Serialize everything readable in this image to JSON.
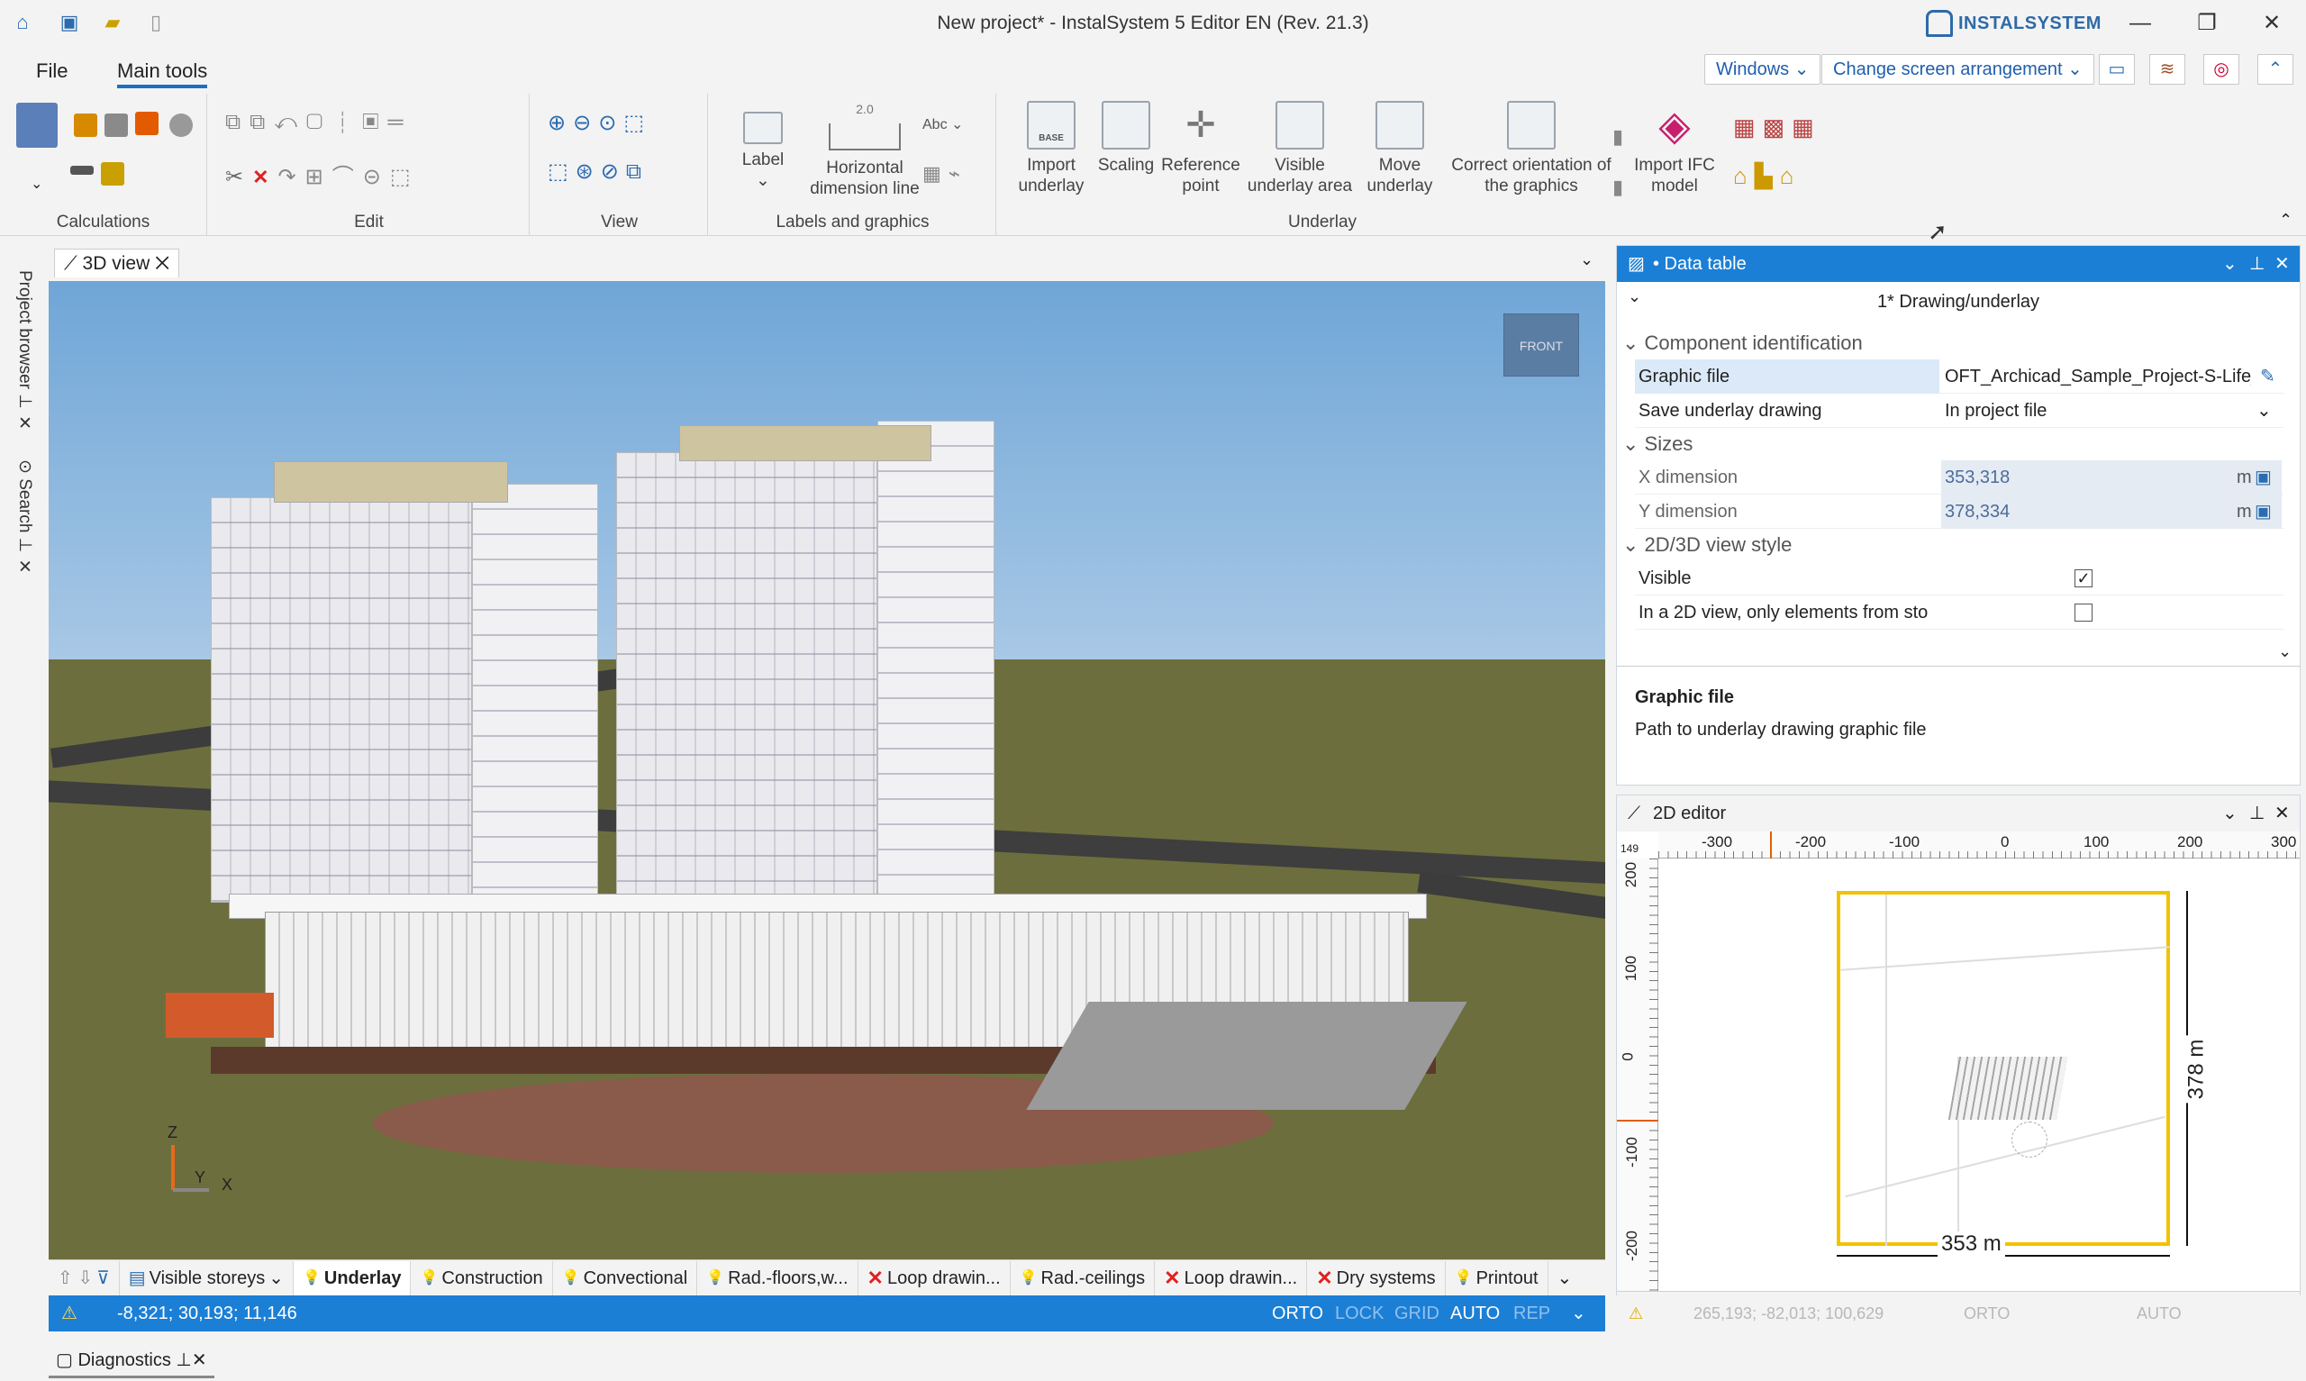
{
  "window": {
    "title": "New project* - InstalSystem 5 Editor EN (Rev. 21.3)",
    "brand": "INSTALSYSTEM"
  },
  "menu": {
    "file": "File",
    "main_tools": "Main tools",
    "windows": "Windows",
    "change_arrangement": "Change screen arrangement"
  },
  "ribbon": {
    "groups": {
      "calculations": "Calculations",
      "edit": "Edit",
      "view": "View",
      "labels_graphics": "Labels and graphics",
      "underlay": "Underlay"
    },
    "label": "Label",
    "horizontal_dimension_line": "Horizontal dimension line",
    "dim_value": "2.0",
    "abc": "Abc",
    "import_underlay": "Import underlay",
    "base": "BASE",
    "scaling": "Scaling",
    "reference_point": "Reference point",
    "visible_underlay_area": "Visible underlay area",
    "move_underlay": "Move underlay",
    "correct_orientation": "Correct orientation of the graphics",
    "import_ifc": "Import IFC model"
  },
  "left_tabs": {
    "project_browser": "Project browser",
    "search": "Search"
  },
  "view3d": {
    "tab": "3D view",
    "cube_label": "FRONT",
    "axis_z": "Z",
    "axis_y": "Y",
    "axis_x": "X"
  },
  "layers": {
    "visible_storeys": "Visible storeys",
    "items": [
      "Underlay",
      "Construction",
      "Convectional",
      "Rad.-floors,w...",
      "Loop drawin...",
      "Rad.-ceilings",
      "Loop drawin...",
      "Dry systems",
      "Printout"
    ]
  },
  "status": {
    "coords": "-8,321; 30,193; 11,146",
    "orto": "ORTO",
    "lock": "LOCK",
    "grid": "GRID",
    "auto": "AUTO",
    "rep": "REP"
  },
  "diagnostics": "Diagnostics",
  "data_table": {
    "title": "• Data table",
    "subtitle": "1* Drawing/underlay",
    "sections": {
      "component_identification": "Component identification",
      "sizes": "Sizes",
      "view_style": "2D/3D view style"
    },
    "rows": {
      "graphic_file_label": "Graphic file",
      "graphic_file_value": "OFT_Archicad_Sample_Project-S-Life_E",
      "save_underlay_label": "Save underlay drawing",
      "save_underlay_value": "In project file",
      "x_dim_label": "X dimension",
      "x_dim_value": "353,318",
      "y_dim_label": "Y dimension",
      "y_dim_value": "378,334",
      "unit": "m",
      "visible_label": "Visible",
      "visible_checked": true,
      "only_elements_label": "In a 2D view, only elements from sto",
      "only_elements_checked": false
    },
    "help_title": "Graphic file",
    "help_text": "Path to underlay drawing graphic file"
  },
  "editor2d": {
    "title": "2D editor",
    "hticks": [
      "-300",
      "-200",
      "-100",
      "0",
      "100",
      "200",
      "300"
    ],
    "hstart": "149",
    "vticks": [
      "200",
      "100",
      "0",
      "-100",
      "-200"
    ],
    "width_label": "353 m",
    "height_label": "378 m",
    "storey_value": "0",
    "status_coords": "265,193; -82,013; 100,629",
    "status_orto": "ORTO",
    "status_auto": "AUTO"
  },
  "colors": {
    "accent": "#1c7fd6",
    "selection": "#f2c200"
  }
}
